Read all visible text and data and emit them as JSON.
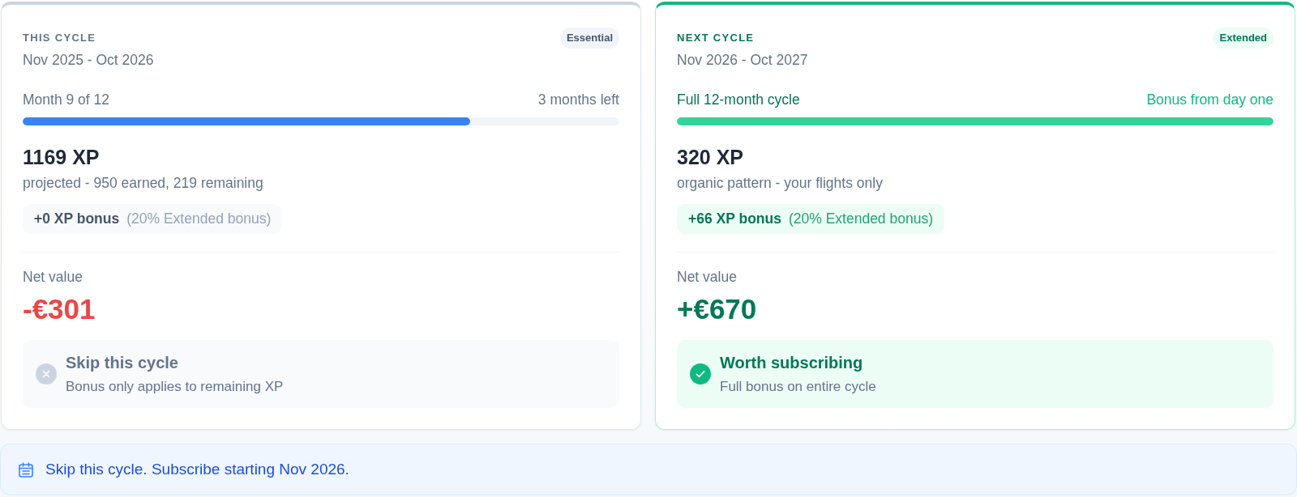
{
  "cycles": [
    {
      "heading": "THIS CYCLE",
      "period": "Nov 2025 - Oct 2026",
      "badge": "Essential",
      "highlighted": false,
      "progress": {
        "label": "Month 9 of 12",
        "note": "3 months left",
        "level": 0.75
      },
      "xp": {
        "total": "1169 XP",
        "detail": "projected - 950 earned, 219 remaining"
      },
      "bonus": {
        "amount": "+0 XP bonus",
        "note": "(20% Extended bonus)"
      },
      "net_value": {
        "label": "Net value",
        "amount": "-€301",
        "kind": "loss"
      },
      "verdict": {
        "kind": "skip",
        "title": "Skip this cycle",
        "detail": "Bonus only applies to remaining XP"
      }
    },
    {
      "heading": "NEXT CYCLE",
      "period": "Nov 2026 - Oct 2027",
      "badge": "Extended",
      "highlighted": true,
      "progress": {
        "label": "Full 12-month cycle",
        "note": "Bonus from day one",
        "level": 1
      },
      "xp": {
        "total": "320 XP",
        "detail": "organic pattern - your flights only"
      },
      "bonus": {
        "amount": "+66 XP bonus",
        "note": "(20% Extended bonus)"
      },
      "net_value": {
        "label": "Net value",
        "amount": "+€670",
        "kind": "gain"
      },
      "verdict": {
        "kind": "subscribe",
        "title": "Worth subscribing",
        "detail": "Full bonus on entire cycle"
      }
    }
  ],
  "recommendation": {
    "text": "Skip this cycle. Subscribe starting Nov 2026."
  }
}
